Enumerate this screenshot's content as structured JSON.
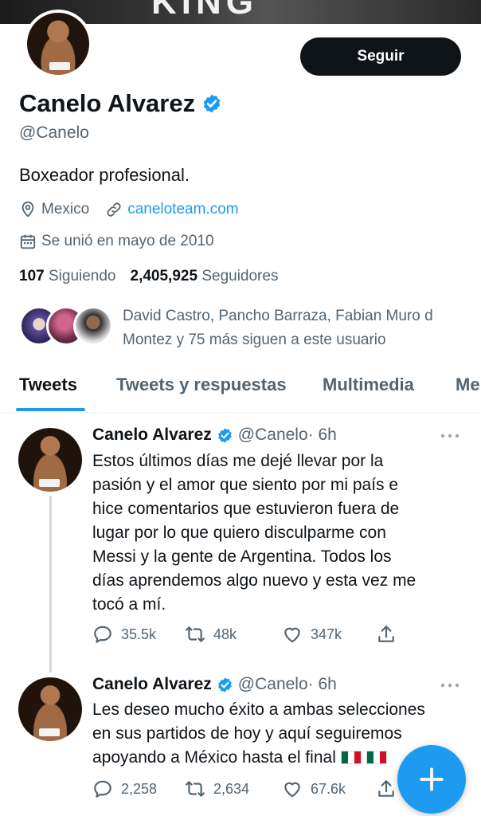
{
  "banner": {
    "text": "KING"
  },
  "profile": {
    "follow_label": "Seguir",
    "name": "Canelo Alvarez",
    "handle": "@Canelo",
    "bio": "Boxeador profesional.",
    "location": "Mexico",
    "website": "caneloteam.com",
    "joined": "Se unió en mayo de 2010",
    "following_count": "107",
    "following_label": "Siguiendo",
    "followers_count": "2,405,925",
    "followers_label": "Seguidores",
    "mutuals_line1": "David Castro, Pancho Barraza, Fabian Muro d",
    "mutuals_line2": "Montez y 75 más siguen a este usuario"
  },
  "tabs": [
    {
      "label": "Tweets",
      "active": true
    },
    {
      "label": "Tweets y respuestas",
      "active": false
    },
    {
      "label": "Multimedia",
      "active": false
    },
    {
      "label": "Me",
      "active": false
    }
  ],
  "tweets": [
    {
      "name": "Canelo Alvarez",
      "handle": "@Canelo",
      "time": "· 6h",
      "lines": [
        "Estos últimos días me dejé llevar por la",
        "pasión y el amor que siento por mi país e",
        "hice comentarios que estuvieron fuera de",
        "lugar por lo que quiero disculparme con",
        "Messi y la gente de Argentina. Todos los",
        "días aprendemos algo nuevo y esta vez me",
        "tocó a mí."
      ],
      "replies": "35.5k",
      "retweets": "48k",
      "likes": "347k"
    },
    {
      "name": "Canelo Alvarez",
      "handle": "@Canelo",
      "time": "· 6h",
      "lines": [
        "Les deseo mucho éxito a ambas selecciones",
        "en sus partidos de hoy y aquí seguiremos",
        "apoyando a México hasta el final"
      ],
      "replies": "2,258",
      "retweets": "2,634",
      "likes": "67.6k"
    }
  ],
  "colors": {
    "accent": "#1d9bf0",
    "text": "#0f1419",
    "muted": "#536471"
  }
}
